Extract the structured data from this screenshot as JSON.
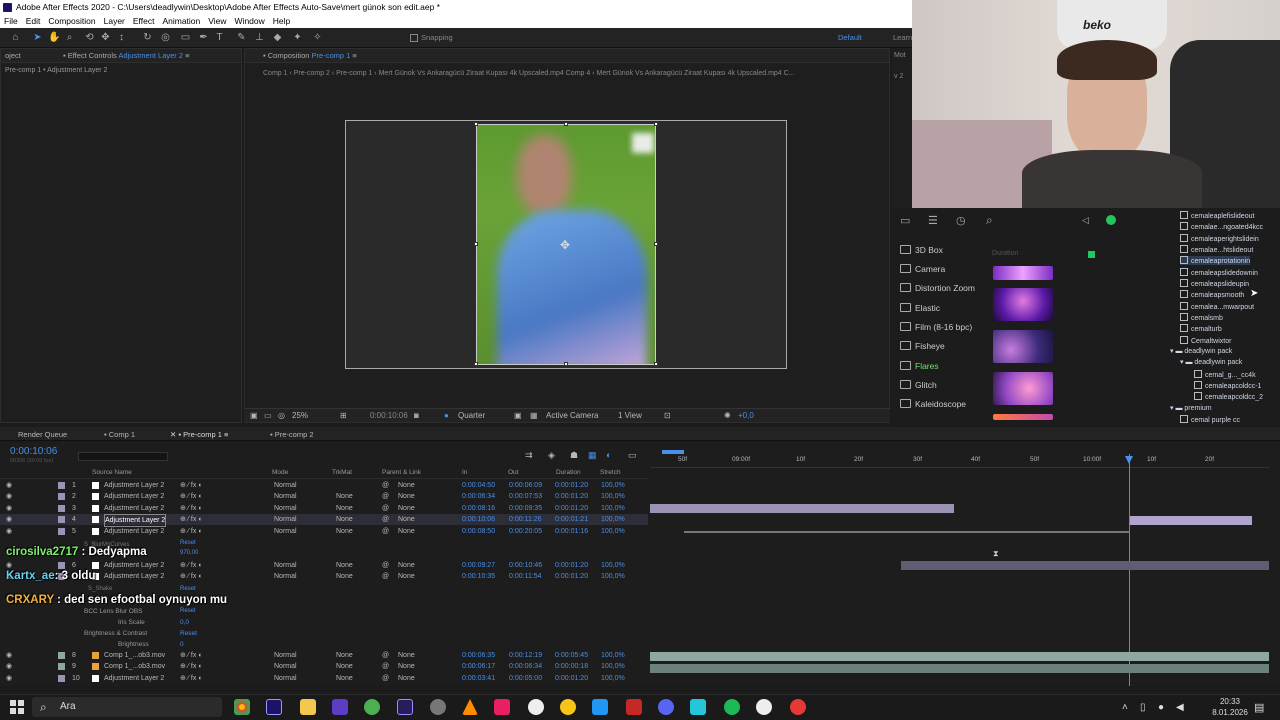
{
  "window": {
    "title": "Adobe After Effects 2020 - C:\\Users\\deadlywin\\Desktop\\Adobe After Effects Auto-Save\\mert günok son edit.aep *"
  },
  "menu": [
    "File",
    "Edit",
    "Composition",
    "Layer",
    "Effect",
    "Animation",
    "View",
    "Window",
    "Help"
  ],
  "toolbar": {
    "snapping_label": "Snapping",
    "workspace_label": "Default",
    "learn_label": "Learn"
  },
  "effect_controls": {
    "tab_label": "Effect Controls",
    "tab_target": "Adjustment Layer 2",
    "project_label": "oject",
    "layer_path": "Pre-comp 1 • Adjustment Layer 2"
  },
  "composition": {
    "tab_label": "Composition",
    "tab_target": "Pre-comp 1",
    "breadcrumbs": [
      "Comp 1",
      "Pre-comp 2",
      "Pre-comp 1",
      "Mert Günok Vs Ankaragücü Ziraat Kupası 4k Upscaled.mp4 Comp 4",
      "Mert Günok Vs Ankaragücü Ziraat Kupası 4k Upscaled.mp4 C..."
    ],
    "zoom": "25%",
    "timecode": "0:00:10:06",
    "resolution": "Quarter",
    "camera": "Active Camera",
    "views": "1 View",
    "exposure": "+0,0"
  },
  "side_panel": {
    "label1": "Mot",
    "label2": "v 2"
  },
  "timeline": {
    "tabs": [
      "Render Queue",
      "Comp 1",
      "Pre-comp 1",
      "Pre-comp 2"
    ],
    "timecode": "0:00:10:06",
    "timecode_sub": "00306 (30.00 fps)",
    "columns": {
      "source": "Source Name",
      "mode": "Mode",
      "trkmat": "TrkMat",
      "parent": "Parent & Link",
      "in": "In",
      "out": "Out",
      "duration": "Duration",
      "stretch": "Stretch"
    },
    "ruler": [
      "50f",
      "09:00f",
      "10f",
      "20f",
      "30f",
      "40f",
      "50f",
      "10:00f",
      "10f",
      "20f"
    ],
    "layers": [
      {
        "num": "1",
        "name": "Adjustment Layer 2",
        "mode": "Normal",
        "trkmat": "",
        "parent": "None",
        "in": "0:00:04:50",
        "out": "0:00:06:09",
        "dur": "0:00:01:20",
        "stretch": "100,0%"
      },
      {
        "num": "2",
        "name": "Adjustment Layer 2",
        "mode": "Normal",
        "trkmat": "None",
        "parent": "None",
        "in": "0:00:06:34",
        "out": "0:00:07:53",
        "dur": "0:00:01:20",
        "stretch": "100,0%"
      },
      {
        "num": "3",
        "name": "Adjustment Layer 2",
        "mode": "Normal",
        "trkmat": "None",
        "parent": "None",
        "in": "0:00:08:16",
        "out": "0:00:09:35",
        "dur": "0:00:01:20",
        "stretch": "100,0%"
      },
      {
        "num": "4",
        "name": "Adjustment Layer 2",
        "mode": "Normal",
        "trkmat": "None",
        "parent": "None",
        "in": "0:00:10:06",
        "out": "0:00:11:26",
        "dur": "0:00:01:21",
        "stretch": "100,0%"
      },
      {
        "num": "5",
        "name": "Adjustment Layer 2",
        "mode": "Normal",
        "trkmat": "None",
        "parent": "None",
        "in": "0:00:08:50",
        "out": "0:00:20:05",
        "dur": "0:00:01:16",
        "stretch": "100,0%"
      }
    ],
    "sub1": {
      "label": "S_BlurMoCurves",
      "reset": "Reset",
      "value": "970,00"
    },
    "layers_b": [
      {
        "num": "6",
        "name": "Adjustment Layer 2",
        "mode": "Normal",
        "trkmat": "None",
        "parent": "None",
        "in": "0:00:09:27",
        "out": "0:00:10:46",
        "dur": "0:00:01:20",
        "stretch": "100,0%"
      },
      {
        "num": "7",
        "name": "Adjustment Layer 2",
        "mode": "Normal",
        "trkmat": "None",
        "parent": "None",
        "in": "0:00:10:35",
        "out": "0:00:11:54",
        "dur": "0:00:01:20",
        "stretch": "100,0%"
      }
    ],
    "sub2": {
      "label": "S_Shake",
      "reset": "Reset",
      "fx": "BCC Lens Blur OBS",
      "fx_reset": "Reset",
      "iris": "Iris Scale",
      "iris_val": "0,0",
      "bc": "Brightness & Contrast",
      "bc_reset": "Reset",
      "brightness": "Brightness",
      "brightness_val": "0"
    },
    "layers_c": [
      {
        "num": "8",
        "name": "Comp 1_...ob3.mov",
        "mode": "Normal",
        "trkmat": "None",
        "parent": "None",
        "in": "0:00:06:35",
        "out": "0:00:12:19",
        "dur": "0:00:05:45",
        "stretch": "100,0%"
      },
      {
        "num": "9",
        "name": "Comp 1_...ob3.mov",
        "mode": "Normal",
        "trkmat": "None",
        "parent": "None",
        "in": "0:00:06:17",
        "out": "0:00:06:34",
        "dur": "0:00:00:18",
        "stretch": "100,0%"
      },
      {
        "num": "10",
        "name": "Adjustment Layer 2",
        "mode": "Normal",
        "trkmat": "None",
        "parent": "None",
        "in": "0:00:03:41",
        "out": "0:00:05:00",
        "dur": "0:00:01:20",
        "stretch": "100,0%"
      }
    ]
  },
  "chat": [
    {
      "user": "cirosilva2717",
      "text": " : Dedyapma",
      "color": "#7cf26a"
    },
    {
      "user": "Kartx_ae",
      "text": ": 3 oldu",
      "color": "#6ad0f2"
    },
    {
      "user": "CRXARY",
      "text": " : ded sen efootbal oynuyon mu",
      "color": "#f2b13c"
    }
  ],
  "fx_panel": {
    "duration_label": "Duration",
    "categories": [
      "3D Box",
      "Camera",
      "Distortion Zoom",
      "Elastic",
      "Film (8-16 bpc)",
      "Fisheye",
      "Flares",
      "Glitch",
      "Kaleidoscope"
    ],
    "selected": "Flares"
  },
  "preset_tree": {
    "items": [
      "cemaleaplefislideout",
      "cemalae...ngoated4kcc",
      "cemaleaperightslidein",
      "cemalae...htslideout",
      "cemaleaprotationin",
      "cemaleapslidedownin",
      "cemaleapslideupin",
      "cemaleapsmooth",
      "cemalea...mwarpout",
      "cemalsmb",
      "cemalturb",
      "Cemaltwixtor"
    ],
    "folder1": "deadlywin pack",
    "folder1b": "deadlywin pack",
    "sub_items": [
      "cemal_g..._cc4k",
      "cemaleapcoldcc-1",
      "cemaleapcoldcc_2"
    ],
    "folder2": "premium",
    "last": "cemal purple cc",
    "highlight": "cemaleaprotationin"
  },
  "webcam": {
    "shirt_text": "beko"
  },
  "taskbar": {
    "search_placeholder": "Ara",
    "time": "20:33",
    "date": "8.01.2026"
  }
}
